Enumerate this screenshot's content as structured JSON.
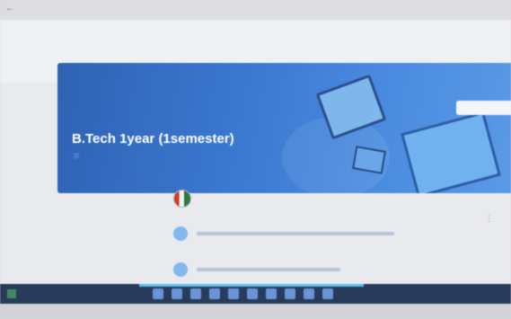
{
  "browser": {
    "url": ""
  },
  "app": {
    "title": ""
  },
  "tabs": [
    {
      "label": "",
      "active": true
    },
    {
      "label": "",
      "active": false
    },
    {
      "label": "",
      "active": false
    },
    {
      "label": "",
      "active": false
    }
  ],
  "banner": {
    "title": "B.Tech 1year (1semester)",
    "info": "ⓘ",
    "customise_label": ""
  },
  "sidebar": {
    "upcoming_label": "",
    "view_all": "",
    "extra_label": "",
    "extra_count": ""
  },
  "stream": {
    "count": "0"
  },
  "colors": {
    "banner": "#3b78d0",
    "accent": "#4a7ec7",
    "taskbar": "#283b5a"
  }
}
